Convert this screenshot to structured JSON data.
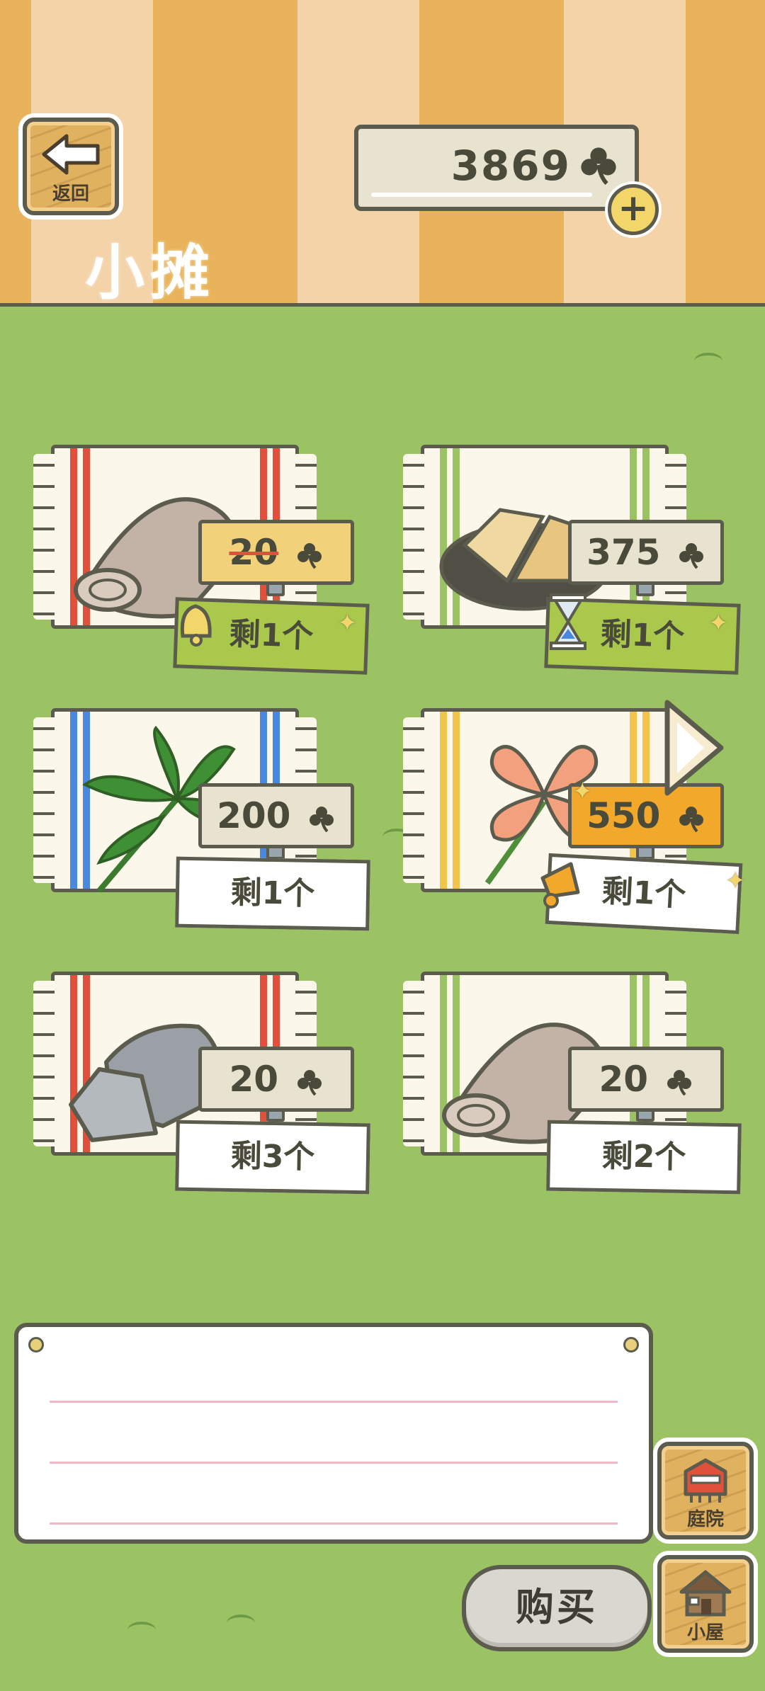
{
  "header": {
    "back_label": "返回",
    "title": "小摊",
    "coin_balance": "3869",
    "add_icon": "plus-icon",
    "currency_icon": "clover-icon"
  },
  "items": [
    {
      "name": "rolled cloth (beige)",
      "icon": "cloth-roll-icon",
      "price": "20",
      "on_sale": true,
      "stock_label": "剩1个",
      "badge_icon": "bell-icon",
      "cloth_stripe": "#e0503a",
      "stock_color": "#a9c84c"
    },
    {
      "name": "pie",
      "icon": "pie-plate-icon",
      "price": "375",
      "on_sale": false,
      "stock_label": "剩1个",
      "badge_icon": "hourglass-icon",
      "cloth_stripe": "#9bc263",
      "stock_color": "#a9c84c"
    },
    {
      "name": "leaf",
      "icon": "leaf-icon",
      "price": "200",
      "on_sale": false,
      "stock_label": "剩1个",
      "badge_icon": "",
      "cloth_stripe": "#4a88e0",
      "stock_color": "#ffffff"
    },
    {
      "name": "four-leaf clover",
      "icon": "four-leaf-clover-icon",
      "price": "550",
      "on_sale": false,
      "stock_label": "剩1个",
      "badge_icon": "megaphone-icon",
      "cloth_stripe": "#f2c44a",
      "stock_color": "#ffffff"
    },
    {
      "name": "rock",
      "icon": "rock-icon",
      "price": "20",
      "on_sale": false,
      "stock_label": "剩3个",
      "badge_icon": "",
      "cloth_stripe": "#e0503a",
      "stock_color": "#ffffff"
    },
    {
      "name": "rolled cloth",
      "icon": "cloth-roll-icon",
      "price": "20",
      "on_sale": false,
      "stock_label": "剩2个",
      "badge_icon": "",
      "cloth_stripe": "#9bc263",
      "stock_color": "#ffffff"
    }
  ],
  "nav": {
    "next_page_icon": "arrow-right-icon",
    "courtyard_label": "庭院",
    "house_label": "小屋",
    "buy_label": "购买"
  },
  "colors": {
    "grass": "#9bc263",
    "stripe_dark": "#e8b35a",
    "stripe_light": "#f4d3a8",
    "outline": "#5b5b4e"
  }
}
